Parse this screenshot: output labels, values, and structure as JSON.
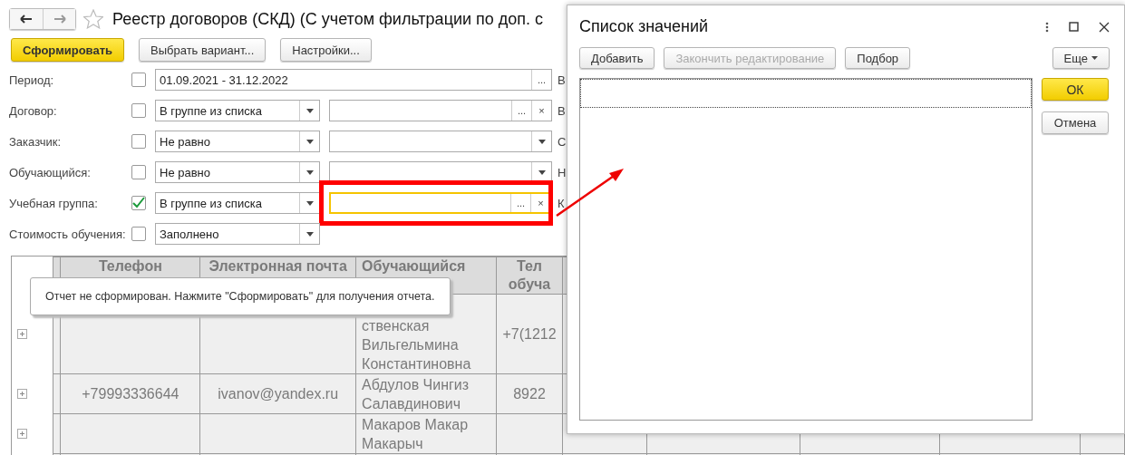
{
  "header": {
    "title": "Реестр договоров (СКД) (С учетом фильтрации по доп. с"
  },
  "toolbar": [
    {
      "label": "Сформировать",
      "kind": "primary"
    },
    {
      "label": "Выбрать вариант...",
      "kind": "normal"
    },
    {
      "label": "Настройки...",
      "kind": "normal"
    }
  ],
  "filters": [
    {
      "label": "Период:",
      "checked": false,
      "kind": "period",
      "value": "01.09.2021 - 31.12.2022",
      "field_buttons": [
        "..."
      ],
      "highlighted": false,
      "cut_label": "В"
    },
    {
      "label": "Договор:",
      "checked": false,
      "kind": "choice",
      "condition": "В группе из списка",
      "field_buttons": [
        "...",
        "×"
      ],
      "highlighted": false,
      "cut_label": "В"
    },
    {
      "label": "Заказчик:",
      "checked": false,
      "kind": "dropdown",
      "condition": "Не равно",
      "highlighted": false,
      "cut_label": "С"
    },
    {
      "label": "Обучающийся:",
      "checked": false,
      "kind": "dropdown",
      "condition": "Не равно",
      "highlighted": false,
      "cut_label": "Н"
    },
    {
      "label": "Учебная группа:",
      "checked": true,
      "kind": "choice",
      "condition": "В группе из списка",
      "field_buttons": [
        "...",
        "×"
      ],
      "highlighted": true,
      "cut_label": "К"
    },
    {
      "label": "Стоимость обучения:",
      "checked": false,
      "kind": "none",
      "condition": "Заполнено",
      "highlighted": false
    }
  ],
  "table": {
    "columns": [
      "Телефон",
      "Электронная почта",
      "Обучающийся",
      "Тел обуча"
    ],
    "rows": [
      {
        "cells": [
          "",
          "",
          "ственская Вильгельмина Константиновна",
          "+7(1212"
        ]
      },
      {
        "cells": [
          "+79993336644",
          "ivanov@yandex.ru",
          "Абдулов Чингиз Салавдинович",
          "8922"
        ]
      },
      {
        "cells": [
          "",
          "",
          "Макаров Макар Макарыч",
          ""
        ]
      }
    ]
  },
  "tooltip": {
    "text": "Отчет не сформирован. Нажмите \"Сформировать\" для получения отчета."
  },
  "dialog": {
    "title": "Список значений",
    "buttons": [
      {
        "label": "Добавить",
        "disabled": false
      },
      {
        "label": "Закончить редактирование",
        "disabled": true
      },
      {
        "label": "Подбор",
        "disabled": false
      }
    ],
    "more": "Еще",
    "ok": "ОК",
    "cancel": "Отмена"
  }
}
